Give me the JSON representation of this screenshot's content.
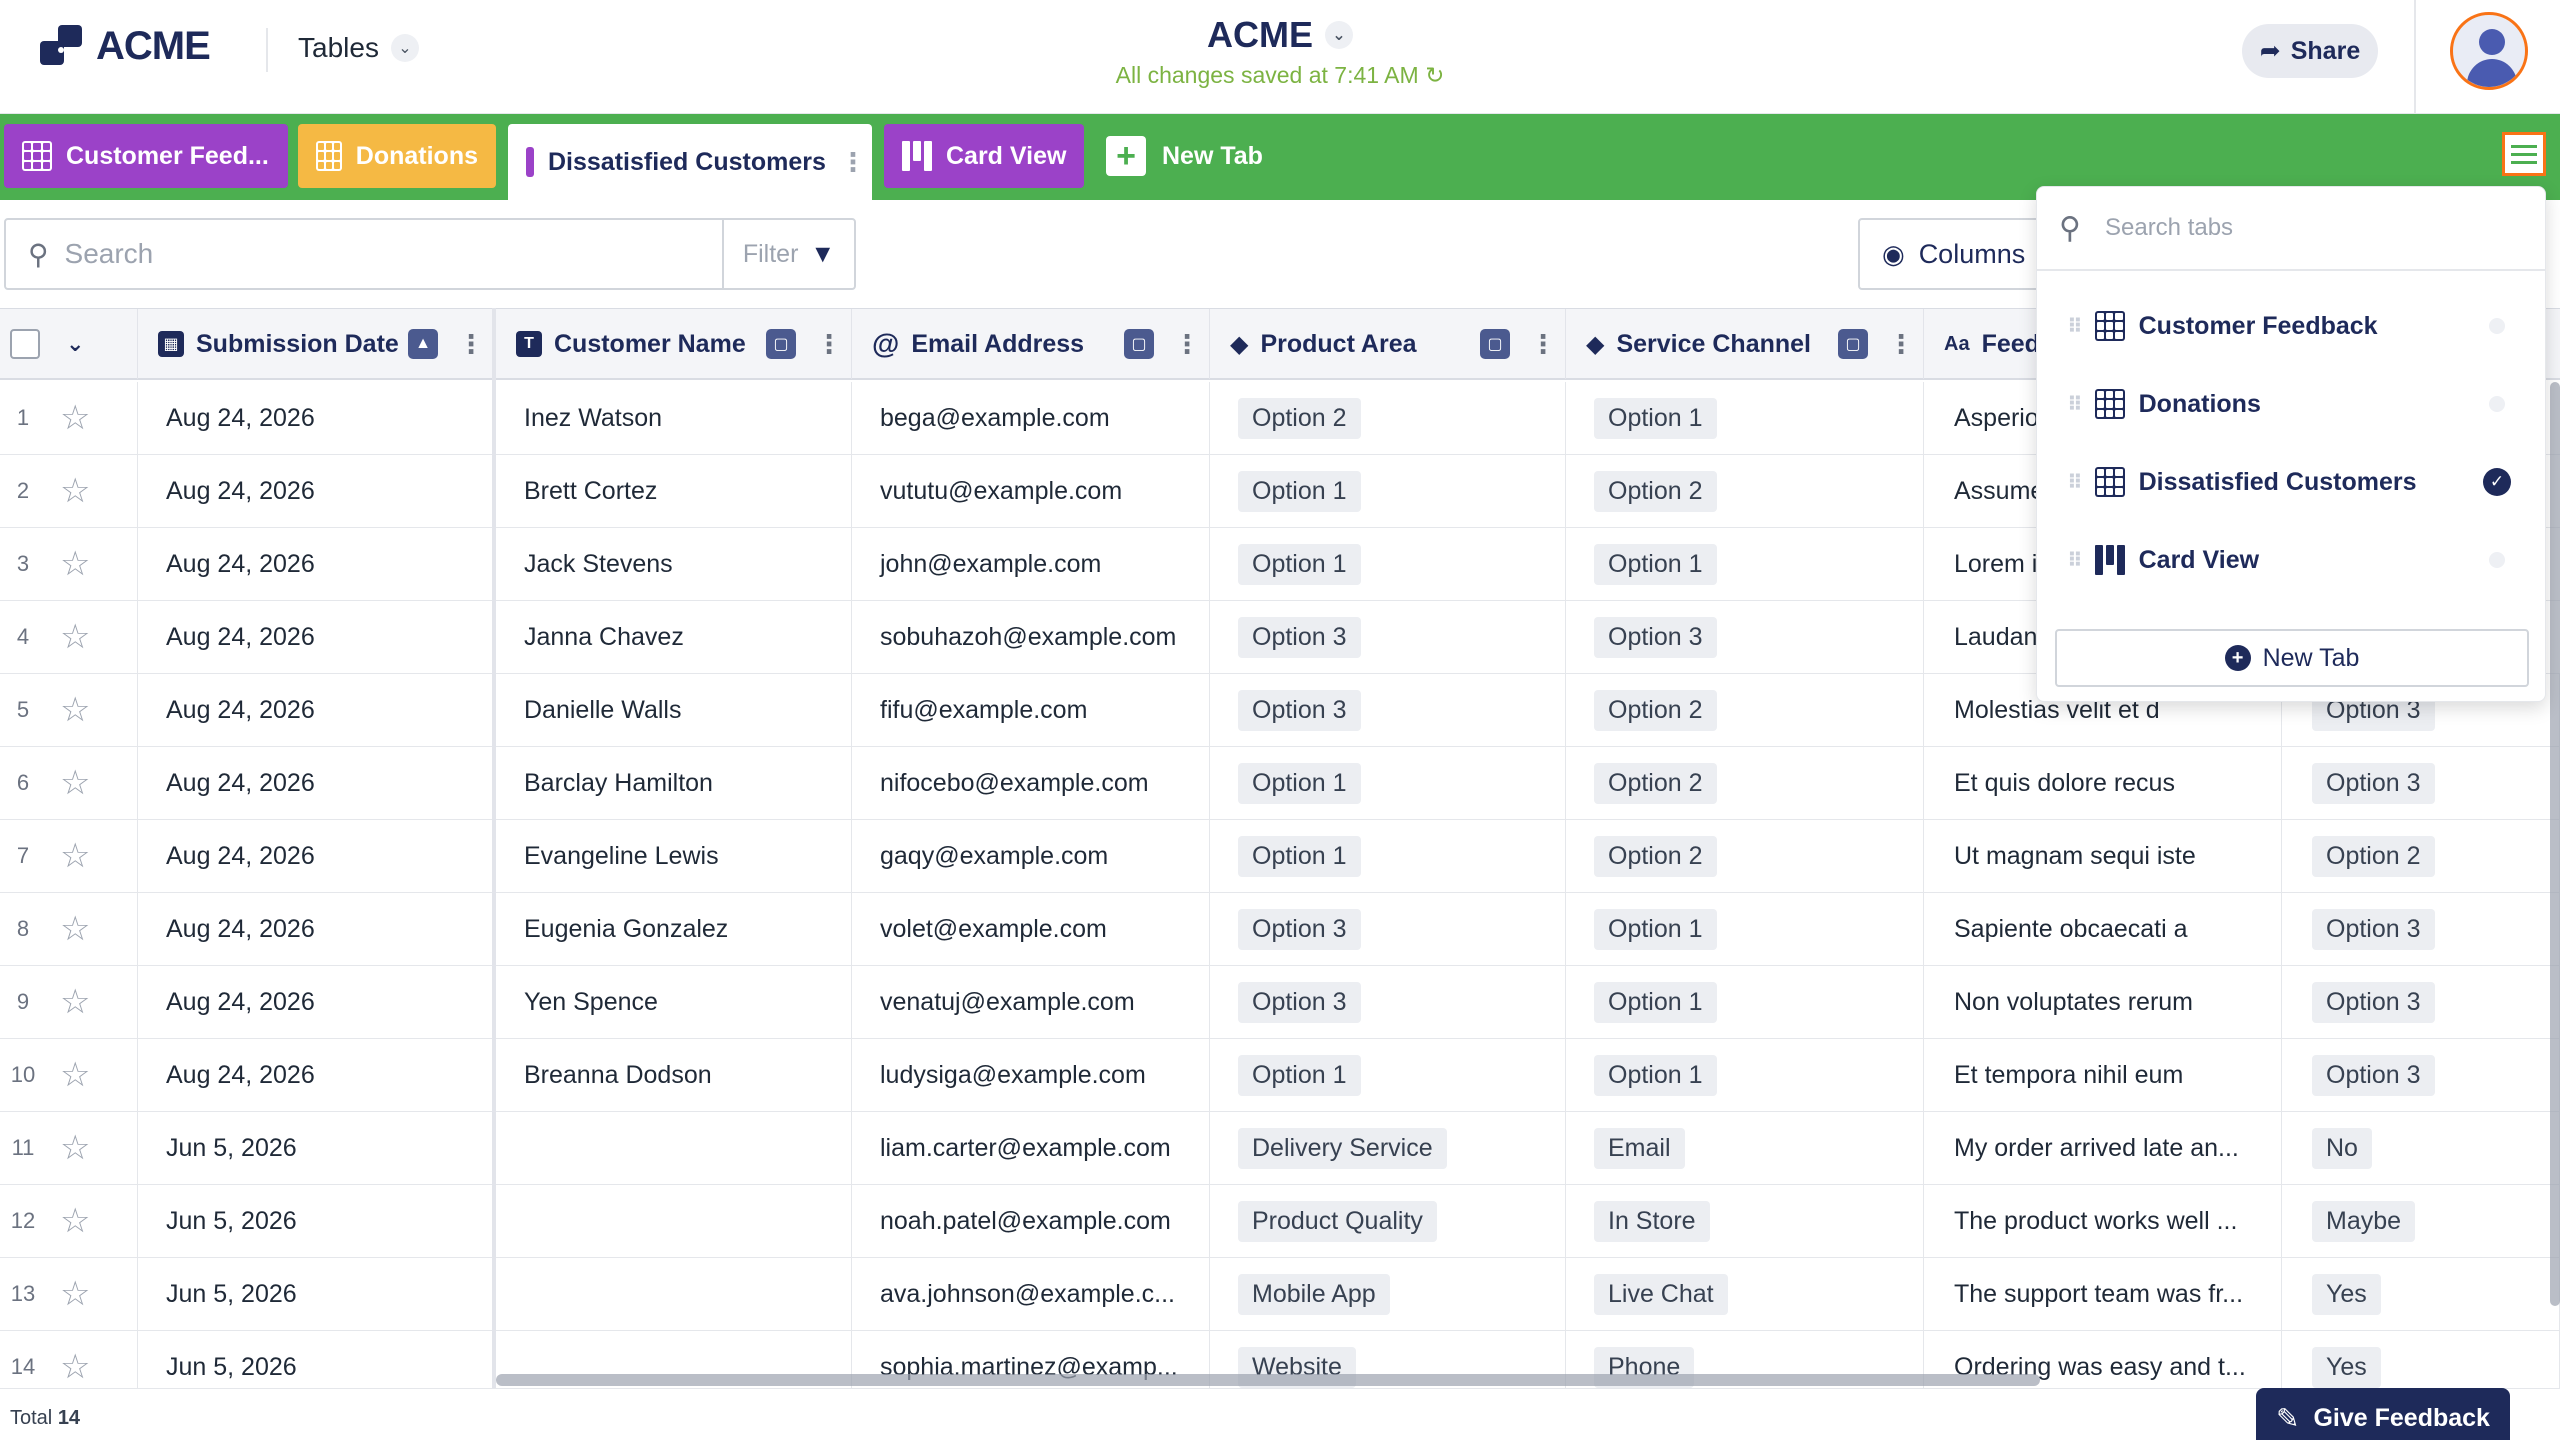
{
  "header": {
    "logo_text": "ACME",
    "tables_label": "Tables",
    "app_title": "ACME",
    "saved_status": "All changes saved at 7:41 AM",
    "share_label": "Share"
  },
  "tabs": [
    {
      "label": "Customer Feed...",
      "color": "#9b42c8",
      "icon": "grid-icon"
    },
    {
      "label": "Donations",
      "color": "#f5b944",
      "icon": "grid-icon"
    },
    {
      "label": "Dissatisfied Customers",
      "color": "#ffffff",
      "icon": "grid-icon",
      "active": true
    },
    {
      "label": "Card View",
      "color": "#9b42c8",
      "icon": "kanban-icon"
    }
  ],
  "new_tab_label": "New Tab",
  "toolbar": {
    "search_placeholder": "Search",
    "filter_label": "Filter",
    "columns_label": "Columns"
  },
  "columns": [
    {
      "label": "Submission Date",
      "icon": "calendar-icon"
    },
    {
      "label": "Customer Name",
      "icon": "text-icon"
    },
    {
      "label": "Email Address",
      "icon": "at-icon"
    },
    {
      "label": "Product Area",
      "icon": "tag-icon"
    },
    {
      "label": "Service Channel",
      "icon": "tag-icon"
    },
    {
      "label": "Feed",
      "icon": "font-icon"
    }
  ],
  "rows": [
    {
      "n": "1",
      "date": "Aug 24, 2026",
      "name": "Inez Watson",
      "email": "bega@example.com",
      "area": "Option 2",
      "channel": "Option 1",
      "feedback": "Asperio",
      "extra": ""
    },
    {
      "n": "2",
      "date": "Aug 24, 2026",
      "name": "Brett Cortez",
      "email": "vututu@example.com",
      "area": "Option 1",
      "channel": "Option 2",
      "feedback": "Assume",
      "extra": ""
    },
    {
      "n": "3",
      "date": "Aug 24, 2026",
      "name": "Jack Stevens",
      "email": "john@example.com",
      "area": "Option 1",
      "channel": "Option 1",
      "feedback": "Lorem i",
      "extra": ""
    },
    {
      "n": "4",
      "date": "Aug 24, 2026",
      "name": "Janna Chavez",
      "email": "sobuhazoh@example.com",
      "area": "Option 3",
      "channel": "Option 3",
      "feedback": "Laudan",
      "extra": ""
    },
    {
      "n": "5",
      "date": "Aug 24, 2026",
      "name": "Danielle Walls",
      "email": "fifu@example.com",
      "area": "Option 3",
      "channel": "Option 2",
      "feedback": "Molestias velit et d",
      "extra": "Option 3"
    },
    {
      "n": "6",
      "date": "Aug 24, 2026",
      "name": "Barclay Hamilton",
      "email": "nifocebo@example.com",
      "area": "Option 1",
      "channel": "Option 2",
      "feedback": "Et quis dolore recus",
      "extra": "Option 3"
    },
    {
      "n": "7",
      "date": "Aug 24, 2026",
      "name": "Evangeline Lewis",
      "email": "gaqy@example.com",
      "area": "Option 1",
      "channel": "Option 2",
      "feedback": "Ut magnam sequi iste",
      "extra": "Option 2"
    },
    {
      "n": "8",
      "date": "Aug 24, 2026",
      "name": "Eugenia Gonzalez",
      "email": "volet@example.com",
      "area": "Option 3",
      "channel": "Option 1",
      "feedback": "Sapiente obcaecati a",
      "extra": "Option 3"
    },
    {
      "n": "9",
      "date": "Aug 24, 2026",
      "name": "Yen Spence",
      "email": "venatuj@example.com",
      "area": "Option 3",
      "channel": "Option 1",
      "feedback": "Non voluptates rerum",
      "extra": "Option 3"
    },
    {
      "n": "10",
      "date": "Aug 24, 2026",
      "name": "Breanna Dodson",
      "email": "ludysiga@example.com",
      "area": "Option 1",
      "channel": "Option 1",
      "feedback": "Et tempora nihil eum",
      "extra": "Option 3"
    },
    {
      "n": "11",
      "date": "Jun 5, 2026",
      "name": "",
      "email": "liam.carter@example.com",
      "area": "Delivery Service",
      "channel": "Email",
      "feedback": "My order arrived late an...",
      "extra": "No"
    },
    {
      "n": "12",
      "date": "Jun 5, 2026",
      "name": "",
      "email": "noah.patel@example.com",
      "area": "Product Quality",
      "channel": "In Store",
      "feedback": "The product works well ...",
      "extra": "Maybe"
    },
    {
      "n": "13",
      "date": "Jun 5, 2026",
      "name": "",
      "email": "ava.johnson@example.c...",
      "area": "Mobile App",
      "channel": "Live Chat",
      "feedback": "The support team was fr...",
      "extra": "Yes"
    },
    {
      "n": "14",
      "date": "Jun 5, 2026",
      "name": "",
      "email": "sophia.martinez@examp...",
      "area": "Website",
      "channel": "Phone",
      "feedback": "Ordering was easy and t...",
      "extra": "Yes"
    }
  ],
  "footer": {
    "total_label": "Total",
    "total_count": "14"
  },
  "feedback_button": "Give Feedback",
  "panel": {
    "search_placeholder": "Search tabs",
    "items": [
      {
        "label": "Customer Feedback",
        "icon": "grid-icon",
        "selected": false
      },
      {
        "label": "Donations",
        "icon": "grid-icon",
        "selected": false
      },
      {
        "label": "Dissatisfied Customers",
        "icon": "grid-icon",
        "selected": true
      },
      {
        "label": "Card View",
        "icon": "kanban-icon",
        "selected": false
      }
    ],
    "new_tab_label": "New Tab"
  },
  "colors": {
    "tabbar": "#4caf50",
    "brand": "#1e2a5a",
    "saved": "#7cb342",
    "accent": "#f97316"
  }
}
